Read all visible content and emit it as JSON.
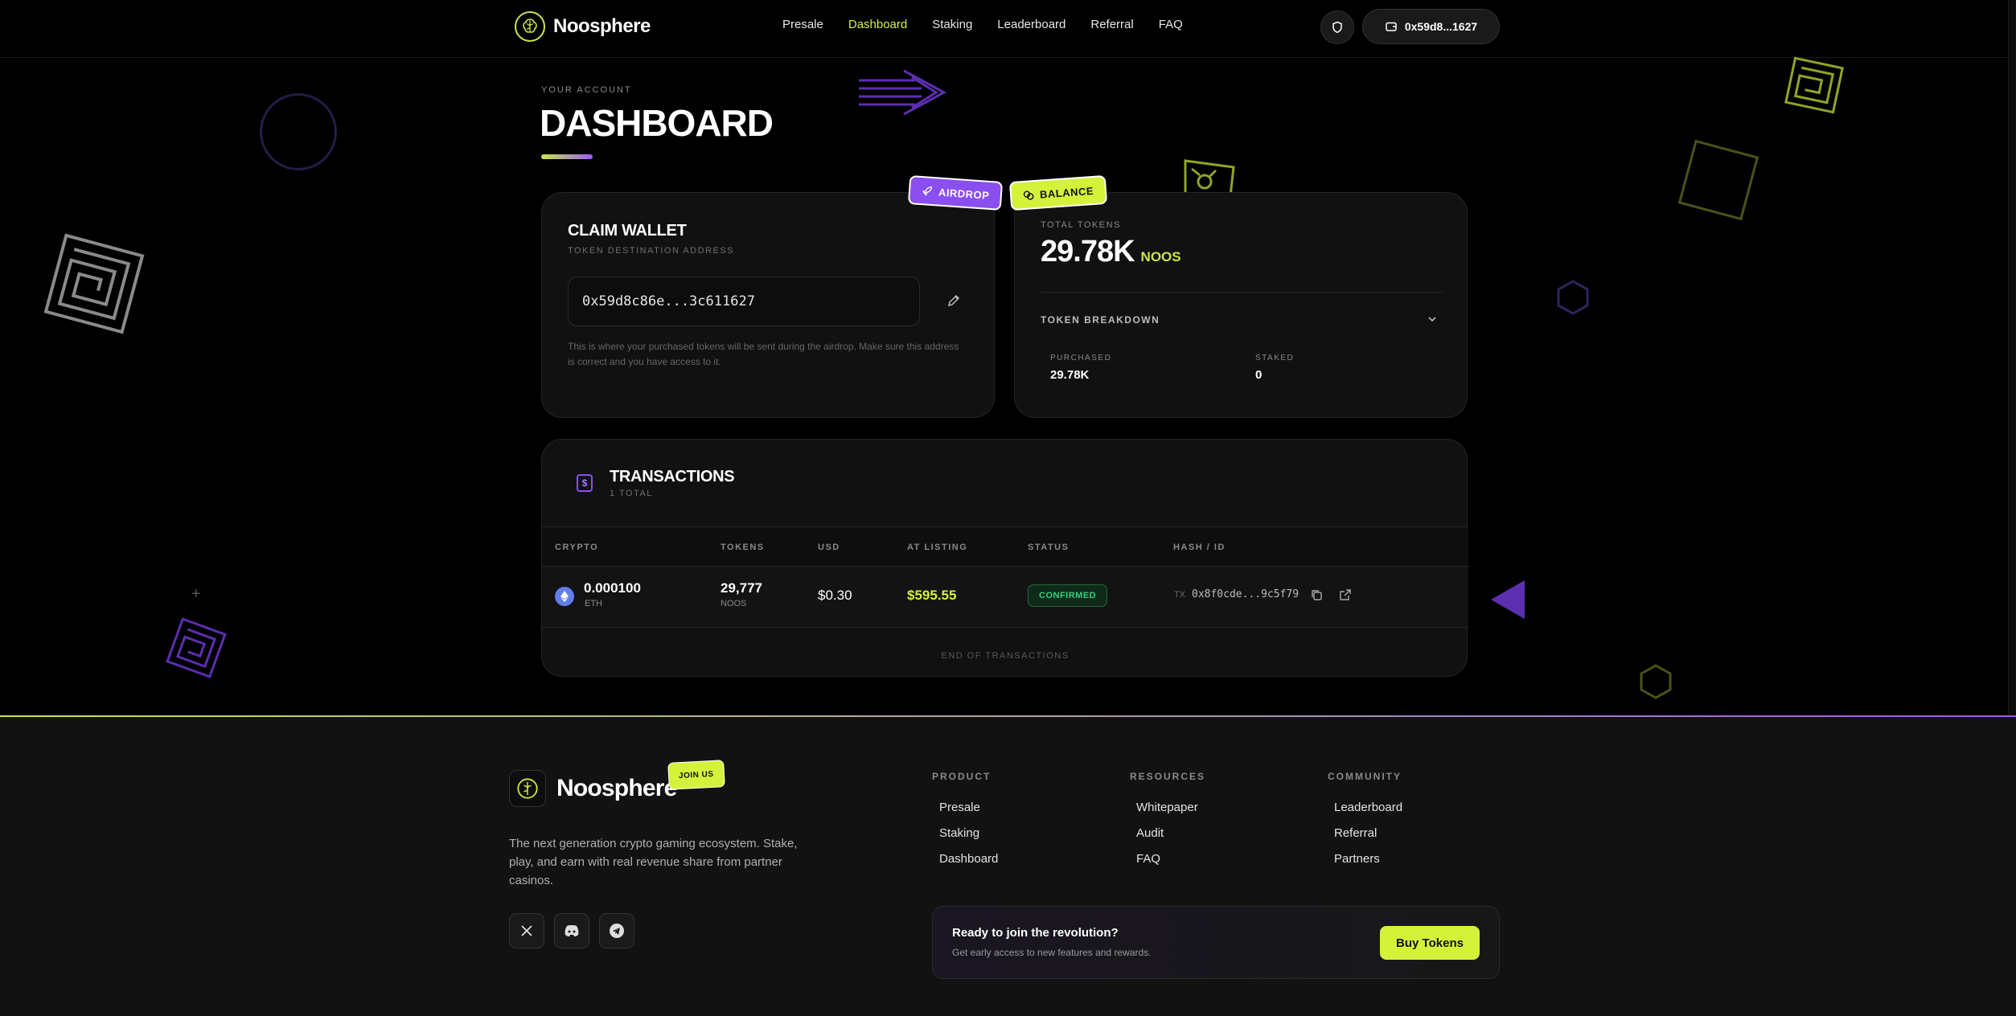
{
  "nav": {
    "brand": "Noosphere",
    "links": [
      "Presale",
      "Dashboard",
      "Staking",
      "Leaderboard",
      "Referral",
      "FAQ"
    ],
    "active_link": "Dashboard",
    "wallet": "0x59d8...1627"
  },
  "header": {
    "eyebrow": "YOUR ACCOUNT",
    "title": "DASHBOARD"
  },
  "claim_card": {
    "tag": "AIRDROP",
    "title": "CLAIM WALLET",
    "subtitle": "TOKEN DESTINATION ADDRESS",
    "address": "0x59d8c86e...3c611627",
    "note": "This is where your purchased tokens will be sent during the airdrop. Make sure this address is correct and you have access to it."
  },
  "balance_card": {
    "tag": "BALANCE",
    "total_label": "TOTAL TOKENS",
    "total_value": "29.78K",
    "unit": "NOOS",
    "breakdown_label": "TOKEN BREAKDOWN",
    "purchased_label": "PURCHASED",
    "purchased_value": "29.78K",
    "staked_label": "STAKED",
    "staked_value": "0"
  },
  "transactions": {
    "title": "TRANSACTIONS",
    "count": "1 TOTAL",
    "columns": [
      "CRYPTO",
      "TOKENS",
      "USD",
      "AT LISTING",
      "STATUS",
      "HASH / ID"
    ],
    "rows": [
      {
        "amount": "0.000100",
        "crypto": "ETH",
        "tokens": "29,777",
        "tokens_unit": "NOOS",
        "usd": "$0.30",
        "at_listing": "$595.55",
        "status": "CONFIRMED",
        "hash_prefix": "TX",
        "hash": "0x8f0cde...9c5f79"
      }
    ],
    "end_label": "END OF TRANSACTIONS"
  },
  "footer": {
    "brand": "Noosphere",
    "join_tag": "JOIN US",
    "description": "The next generation crypto gaming ecosystem. Stake, play, and earn with real revenue share from partner casinos.",
    "columns": [
      {
        "heading": "PRODUCT",
        "links": [
          "Presale",
          "Staking",
          "Dashboard"
        ]
      },
      {
        "heading": "RESOURCES",
        "links": [
          "Whitepaper",
          "Audit",
          "FAQ"
        ]
      },
      {
        "heading": "COMMUNITY",
        "links": [
          "Leaderboard",
          "Referral",
          "Partners"
        ]
      }
    ],
    "cta_title": "Ready to join the revolution?",
    "cta_subtitle": "Get early access to new features and rewards.",
    "cta_button": "Buy Tokens",
    "social_icons": [
      "x-icon",
      "discord-icon",
      "telegram-icon"
    ]
  },
  "colors": {
    "accent_lime": "#d4f23a",
    "accent_purple": "#8b4ef0",
    "confirmed_green": "#34d17a",
    "background": "#000000"
  }
}
